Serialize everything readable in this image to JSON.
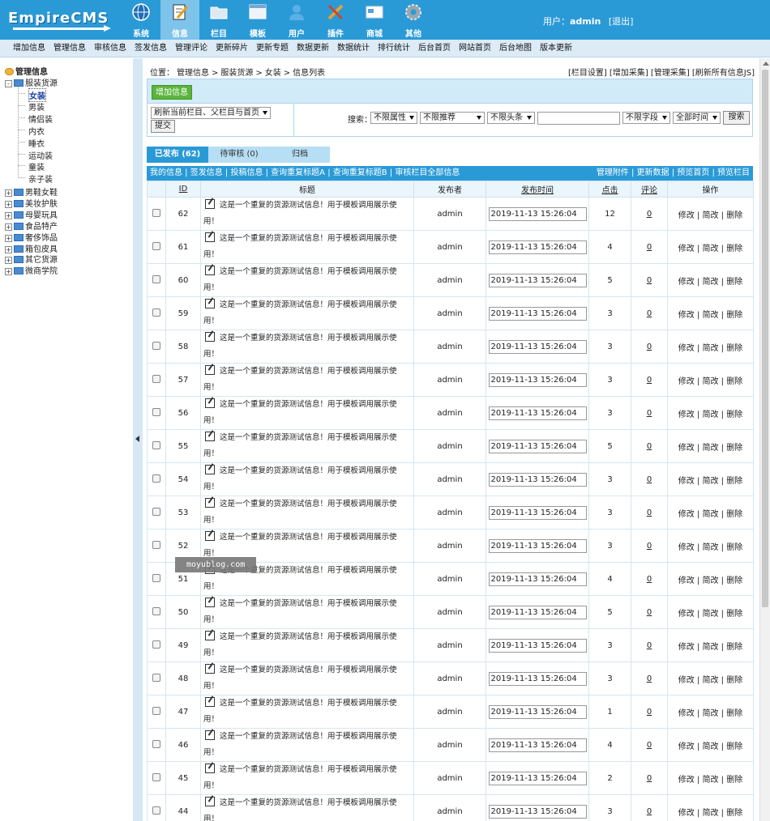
{
  "brand": {
    "logo_text": "EmpireCMS"
  },
  "top_nav": [
    {
      "label": "系统",
      "icon": "globe-icon"
    },
    {
      "label": "信息",
      "icon": "edit-document-icon",
      "active": true
    },
    {
      "label": "栏目",
      "icon": "folder-icon"
    },
    {
      "label": "模板",
      "icon": "template-window-icon"
    },
    {
      "label": "用户",
      "icon": "user-icon"
    },
    {
      "label": "插件",
      "icon": "tools-icon"
    },
    {
      "label": "商城",
      "icon": "card-icon"
    },
    {
      "label": "其他",
      "icon": "gear-icon"
    }
  ],
  "user": {
    "prefix": "用户：",
    "name": "admin",
    "logout": "[退出]"
  },
  "menu": [
    "增加信息",
    "管理信息",
    "审核信息",
    "签发信息",
    "管理评论",
    "更新碎片",
    "更新专题",
    "数据更新",
    "数据统计",
    "排行统计",
    "后台首页",
    "网站首页",
    "后台地图",
    "版本更新"
  ],
  "tree": {
    "root": "管理信息",
    "open_folder": "服装货源",
    "children": [
      "女装",
      "男装",
      "情侣装",
      "内衣",
      "睡衣",
      "运动装",
      "童装",
      "亲子装"
    ],
    "folders": [
      "男鞋女鞋",
      "美妆护肤",
      "母婴玩具",
      "食品特产",
      "奢侈饰品",
      "箱包皮具",
      "其它货源",
      "微商学院"
    ]
  },
  "breadcrumb": {
    "label": "位置：",
    "items": [
      "管理信息",
      "服装货源",
      "女装",
      "信息列表"
    ],
    "sep": ">"
  },
  "right_links": "[栏目设置] [增加采集] [管理采集] [刷新所有信息JS]",
  "toolbar": {
    "add_button": "增加信息",
    "refresh_select": "刷新当前栏目、父栏目与首页",
    "submit": "提交",
    "search_label": "搜索：",
    "filters": [
      "不限属性",
      "不限推荐",
      "不限头条"
    ],
    "keyword_value": "",
    "field_select": "不限字段",
    "time_select": "全部时间",
    "search_button": "搜索"
  },
  "tabs": [
    "已发布 (62)",
    "待审核 (0)",
    "归档"
  ],
  "action_bar": {
    "left": "我的信息 | 签发信息 | 投稿信息 | 查询重复标题A | 查询重复标题B | 审核栏目全部信息",
    "right": "管理附件 | 更新数据 | 预览首页 | 预览栏目"
  },
  "table": {
    "headers": [
      "",
      "ID",
      "标题",
      "发布者",
      "发布时间",
      "点击",
      "评论",
      "操作"
    ],
    "title_text": "这是一个重复的货源测试信息！用于模板调用展示使用！",
    "author": "admin",
    "time": "2019-11-13 15:26:04",
    "comments": "0",
    "ops": "修改 | 简改 | 删除",
    "rows": [
      {
        "id": "62",
        "hits": "12"
      },
      {
        "id": "61",
        "hits": "4"
      },
      {
        "id": "60",
        "hits": "5"
      },
      {
        "id": "59",
        "hits": "3"
      },
      {
        "id": "58",
        "hits": "3"
      },
      {
        "id": "57",
        "hits": "3"
      },
      {
        "id": "56",
        "hits": "3"
      },
      {
        "id": "55",
        "hits": "5"
      },
      {
        "id": "54",
        "hits": "3"
      },
      {
        "id": "53",
        "hits": "3"
      },
      {
        "id": "52",
        "hits": "3"
      },
      {
        "id": "51",
        "hits": "4"
      },
      {
        "id": "50",
        "hits": "5"
      },
      {
        "id": "49",
        "hits": "3"
      },
      {
        "id": "48",
        "hits": "3"
      },
      {
        "id": "47",
        "hits": "1"
      },
      {
        "id": "46",
        "hits": "4"
      },
      {
        "id": "45",
        "hits": "2"
      },
      {
        "id": "44",
        "hits": "3"
      }
    ],
    "partial_row_title": "这是一个重复的货源测试信息！用于模板调用展示使用！"
  },
  "watermark": "moyublog.com"
}
